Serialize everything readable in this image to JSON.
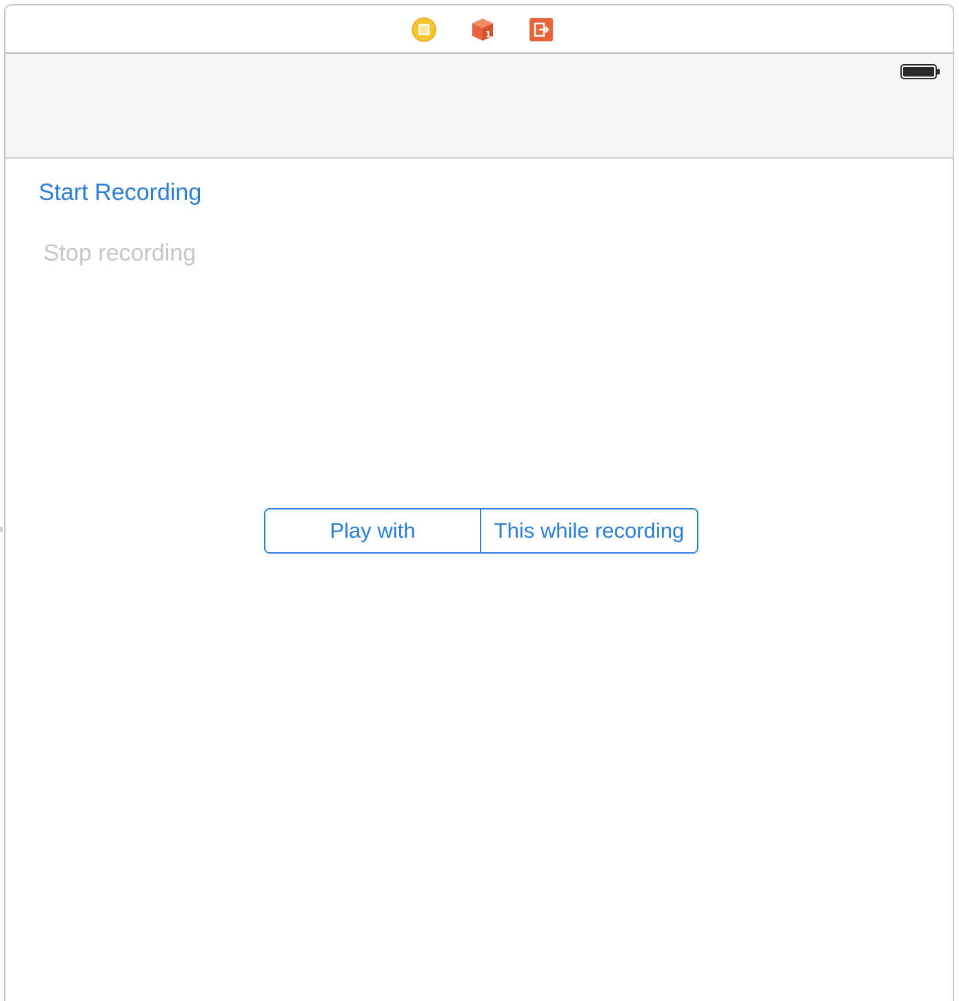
{
  "window": {
    "title": ""
  },
  "scene_dock": {
    "icons": [
      {
        "name": "view-controller-icon",
        "color": "#f6c42e"
      },
      {
        "name": "first-responder-icon",
        "color": "#e8623a"
      },
      {
        "name": "exit-icon",
        "color": "#e8623a"
      }
    ]
  },
  "status_bar": {
    "battery_icon": "battery-icon"
  },
  "main": {
    "start_label": "Start Recording",
    "stop_label": "Stop recording",
    "segmented_control": {
      "segments": [
        "Play with",
        "This while recording"
      ]
    }
  },
  "colors": {
    "tint": "#2a7fd5",
    "disabled": "#c6c6c6",
    "nav_background": "#f6f6f6"
  }
}
